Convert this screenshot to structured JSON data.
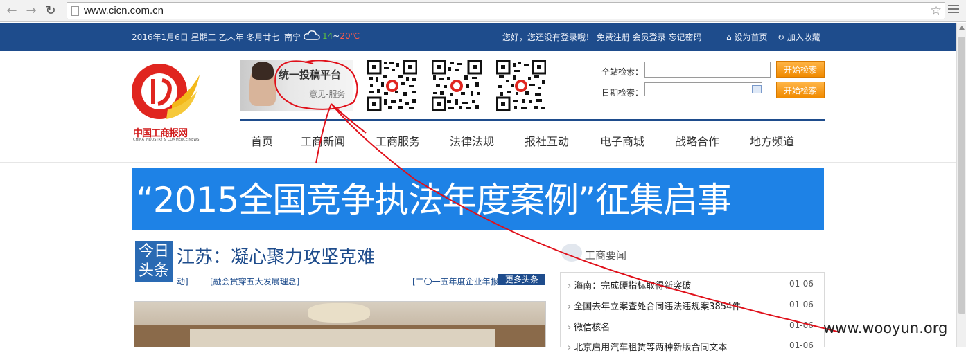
{
  "browser": {
    "url": "www.cicn.com.cn"
  },
  "topbar": {
    "date": "2016年1月6日 星期三 乙未年 冬月廿七",
    "city": "南宁",
    "temp_low": "14",
    "temp_sep": "~",
    "temp_high": "20℃",
    "login_text": "您好，您还没有登录哦！ 免费注册 会员登录 忘记密码",
    "set_home": "设为首页",
    "add_fav": "加入收藏"
  },
  "logo": {
    "text": "中国工商报网",
    "en": "CHINA INDUSTRY & COMMERCE NEWS"
  },
  "banner": {
    "title": "统一投稿平台",
    "subtitle": "意见-服务"
  },
  "search": {
    "site_label": "全站检索：",
    "date_label": "日期检索：",
    "button1": "开始检索",
    "button2": "开始检索",
    "site_value": "",
    "date_value": ""
  },
  "nav": {
    "items": [
      "首页",
      "工商新闻",
      "工商服务",
      "法律法规",
      "报社互动",
      "电子商城",
      "战略合作",
      "地方频道"
    ]
  },
  "ad": {
    "text": "“2015全国竞争执法年度案例”征集启事"
  },
  "headline": {
    "tag": "今日头条",
    "tag1": "今日",
    "tag2": "头条",
    "title": "江苏：凝心聚力攻坚克难",
    "sub1": "动]",
    "sub2": "[融会贯穿五大发展理念]",
    "sub3": "[二〇一五年度企业年报",
    "more": "更多头条>>"
  },
  "news": {
    "title": "工商要闻",
    "items": [
      {
        "text": "海南：完成硬指标取得新突破",
        "date": "01-06"
      },
      {
        "text": "全国去年立案查处合同违法违规案3854件",
        "date": "01-06"
      },
      {
        "text": "微信核名",
        "date": "01-06"
      },
      {
        "text": "北京启用汽车租赁等两种新版合同文本",
        "date": "01-06"
      }
    ]
  },
  "watermark": "www.wooyun.org",
  "colors": {
    "brand_blue": "#1e4c8c",
    "ad_blue": "#1e82e6",
    "button_orange": "#f08a00",
    "annotation_red": "#e0101a"
  }
}
